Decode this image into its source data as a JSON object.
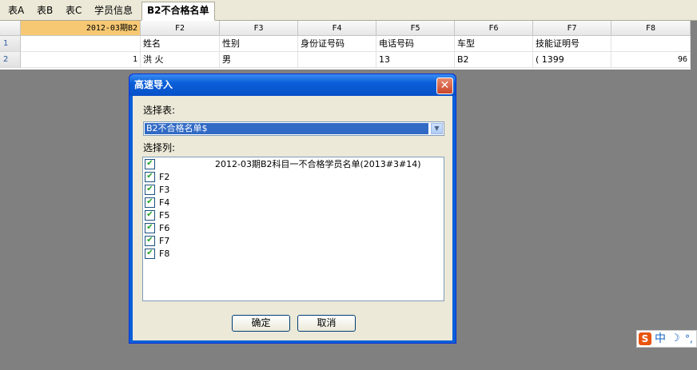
{
  "tabs": [
    "表A",
    "表B",
    "表C",
    "学员信息",
    "B2不合格名单"
  ],
  "grid": {
    "first_col_header": "2012-03期B2",
    "columns": [
      "F2",
      "F3",
      "F4",
      "F5",
      "F6",
      "F7",
      "F8"
    ],
    "row_numbers": [
      "1",
      "2"
    ],
    "rows": [
      [
        "",
        "姓名",
        "性别",
        "身份证号码",
        "电话号码",
        "车型",
        "技能证明号",
        ""
      ],
      [
        "1",
        "洪 火",
        "男",
        "",
        "13",
        "B2",
        "( 1399",
        "96"
      ]
    ]
  },
  "dialog": {
    "title": "高速导入",
    "close_label": "✕",
    "table_label": "选择表:",
    "table_value": "B2不合格名单$",
    "columns_label": "选择列:",
    "column_items": [
      "2012-03期B2科目一不合格学员名单(2013#3#14)",
      "F2",
      "F3",
      "F4",
      "F5",
      "F6",
      "F7",
      "F8"
    ],
    "ok_label": "确定",
    "cancel_label": "取消"
  },
  "ime": {
    "logo": "S",
    "lang": "中",
    "moon": "☽",
    "punct": "°,"
  },
  "colors": {
    "desktop": "#808080",
    "selected_cell": "#f7c873",
    "title_bar": "#0a5fd8",
    "dialog_face": "#ece9d8"
  }
}
